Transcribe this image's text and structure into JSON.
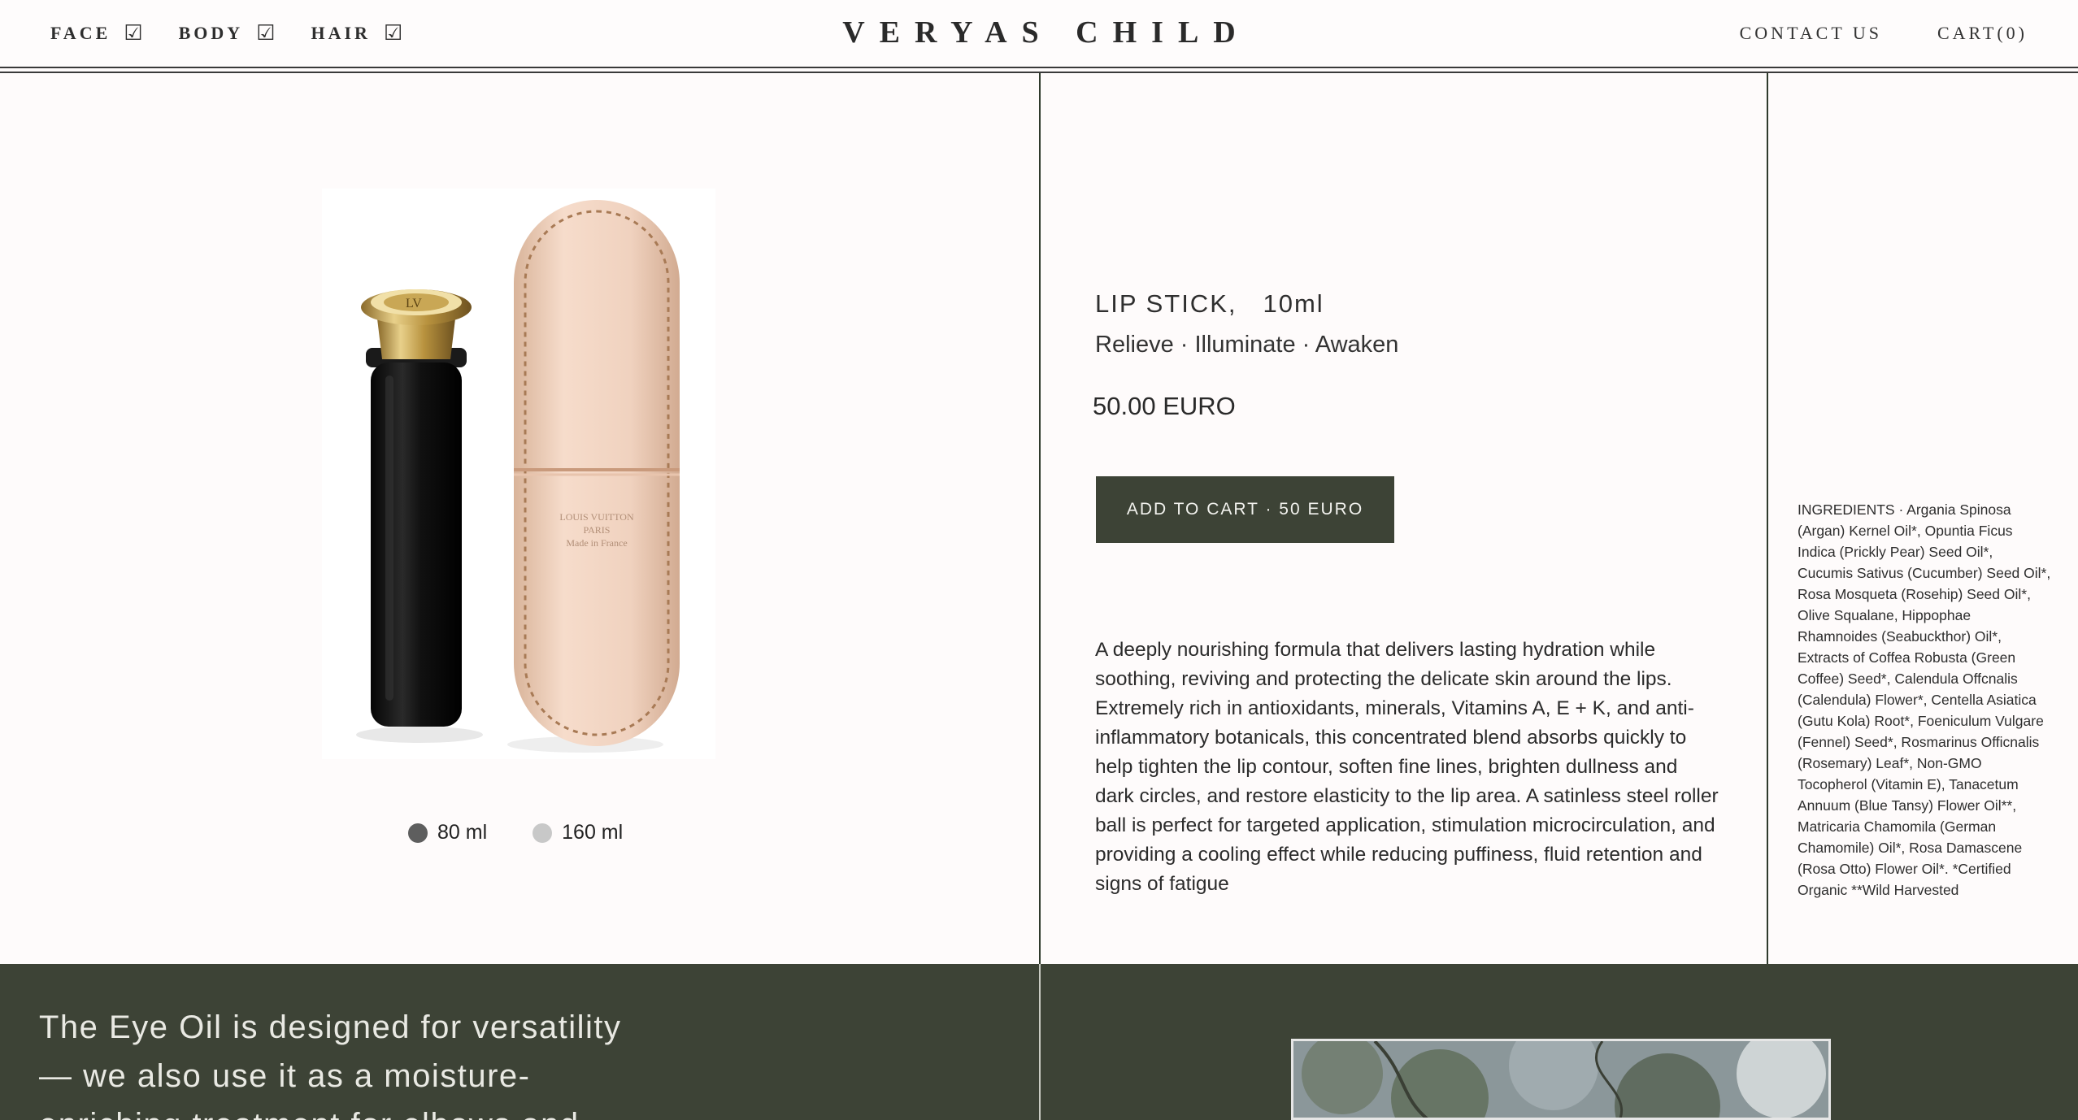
{
  "header": {
    "nav_left": [
      {
        "label": "FACE",
        "check": "☑"
      },
      {
        "label": "BODY",
        "check": "☑"
      },
      {
        "label": "HAIR",
        "check": "☑"
      }
    ],
    "brand": "VERYAS CHILD",
    "contact": "CONTACT US",
    "cart": "CART(0)"
  },
  "product": {
    "name": "LIP STICK,",
    "volume": "10ml",
    "tagline": "Relieve · Illuminate · Awaken",
    "price": "50.00 EURO",
    "add_to_cart": "ADD TO CART · 50 EURO",
    "sizes": [
      {
        "label": "80 ml",
        "selected": true
      },
      {
        "label": "160 ml",
        "selected": false
      }
    ],
    "description": "A deeply nourishing formula that delivers lasting hydration while soothing, reviving and protecting the delicate skin around the lips. Extremely rich in antioxidants, minerals, Vitamins A, E + K, and anti-inflammatory botanicals, this concentrated blend absorbs quickly to help tighten the lip contour, soften fine lines, brighten dullness and dark circles, and restore elasticity to the lip area. A satinless steel roller ball is perfect for targeted application, stimulation microcirculation, and providing a cooling effect while reducing puffiness, fluid retention and signs of fatigue",
    "ingredients": "INGREDIENTS · Argania Spinosa (Argan) Kernel Oil*, Opuntia Ficus Indica (Prickly Pear) Seed Oil*, Cucumis Sativus (Cucumber) Seed Oil*, Rosa Mosqueta (Rosehip) Seed Oil*, Olive Squalane, Hippophae Rhamnoides (Seabuckthor) Oil*, Extracts of Coffea Robusta (Green Coffee) Seed*, Calendula Offcnalis (Calendula) Flower*, Centella Asiatica (Gutu Kola) Root*, Foeniculum Vulgare (Fennel) Seed*, Rosmarinus Officnalis (Rosemary) Leaf*, Non-GMO Tocopherol (Vitamin E), Tanacetum Annuum (Blue Tansy) Flower Oil**, Matricaria Chamomila (German Chamomile) Oil*, Rosa Damascene (Rosa Otto) Flower Oil*. *Certified Organic **Wild Harvested",
    "image_icon": "lipstick-and-case-photo",
    "case_stamp": [
      "LOUIS VUITTON",
      "PARIS",
      "Made in France"
    ]
  },
  "promo": {
    "text": "The Eye Oil is designed for versatility — we also use it as a moisture-enriching treatment for elbows and"
  },
  "colors": {
    "accent_dark_green": "#3d4336",
    "page_background": "#fefbfb",
    "band_text": "#e9e9e3"
  }
}
